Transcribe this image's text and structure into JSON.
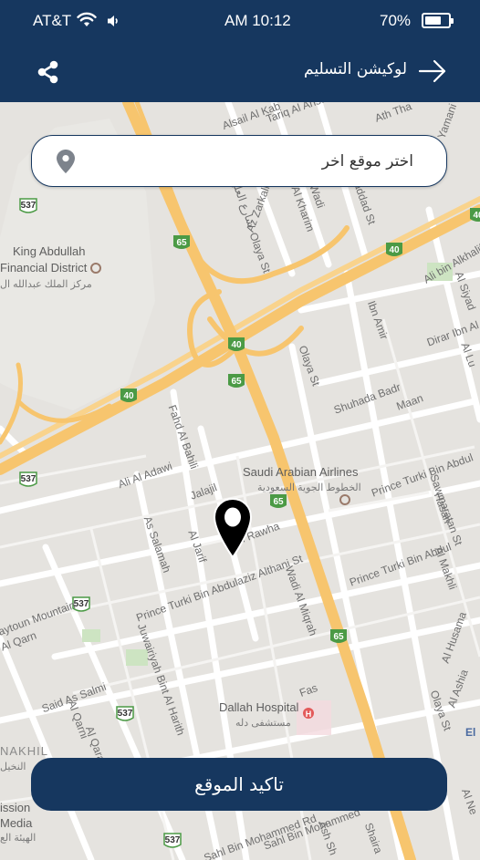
{
  "status": {
    "carrier": "AT&T",
    "time": "AM 10:12",
    "battery": "70%",
    "battery_level": 0.7
  },
  "header": {
    "title": "لوكيشن التسليم",
    "share_icon": "share-icon",
    "back_icon": "arrow-right-icon"
  },
  "search": {
    "placeholder": "اختر موقع اخر",
    "icon": "location-pin-icon"
  },
  "map": {
    "streets": [
      "Alsail Al Kab",
      "Tariq Al Ansa",
      "Ath Tha",
      "Yamani",
      "Haddad St",
      "Al Kharim",
      "Az Zarkali",
      "Olaya St",
      "شارع العليا",
      "Wadi",
      "Ali bin Alkhalif",
      "Al Siyad",
      "Dirar Ibn Al Az",
      "Ibn Amir",
      "Olaya St",
      "Shuhada Badr",
      "Maan",
      "Al Lu",
      "Fahd Al Bahili",
      "Ali Al Adawi",
      "Jalajil",
      "Al Jarif",
      "Al Rawha",
      "As Salamah",
      "Prince Turki Bin Abdulaziz Althani St",
      "Wadi Al Miqrah",
      "Prince Turki Bin Abdul",
      "Sawmaratan St",
      "Hasan",
      "Al Makhli",
      "Al Husama",
      "Al Ashia",
      "Olaya St",
      "Prince Turki Bin Abdul",
      "Juwairiyah Bint Al Harith",
      "Said As Salmi",
      "Al Qarni",
      "Al Qarah",
      "Fas",
      "Jaytoun Mountain",
      "Al Qarn",
      "Sahl Bin Mohammed Rd",
      "Sahl Bin Mohammed",
      "Ash Sh",
      "Shaira",
      "El",
      "Al Ne"
    ],
    "route_shields": [
      "537",
      "65",
      "40",
      "40",
      "40",
      "65",
      "40",
      "537",
      "65",
      "537",
      "537",
      "65",
      "537"
    ],
    "pois": [
      {
        "name": "King Abdullah",
        "name2": "Financial District",
        "name_ar": "مركز الملك عبدالله ال"
      },
      {
        "name": "Saudi Arabian Airlines",
        "name_ar": "الخطوط الجوية السعودية"
      },
      {
        "name": "Dallah Hospital",
        "name_ar": "مستشفى دله"
      },
      {
        "name": "NAKHIL",
        "name_ar": "النخيل"
      },
      {
        "name": "ission",
        "name2": "Media",
        "name_ar": "الهيئة الع"
      }
    ]
  },
  "pin_icon": "map-marker-icon",
  "confirm": {
    "label": "تاكيد الموقع"
  }
}
